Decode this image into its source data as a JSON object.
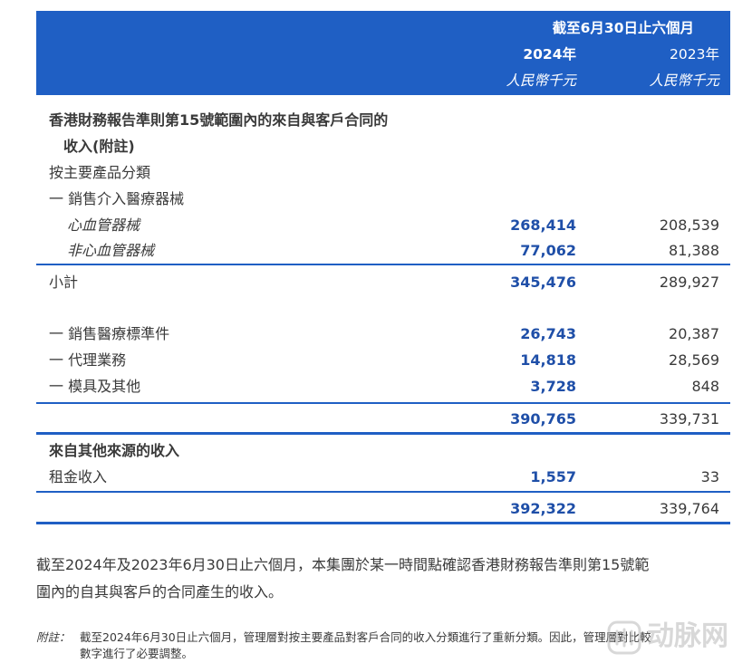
{
  "header": {
    "period": "截至6月30日止六個月",
    "year_current": "2024年",
    "year_prior": "2023年",
    "unit_current": "人民幣千元",
    "unit_prior": "人民幣千元"
  },
  "section1": {
    "title_line1": "香港財務報告準則第15號範圍內的來自與客戶合同的",
    "title_line2": "收入(附註)",
    "subtitle": "按主要產品分類",
    "group1_label": "一 銷售介入醫療器械",
    "rows": [
      {
        "label": "心血管器械",
        "v2024": "268,414",
        "v2023": "208,539"
      },
      {
        "label": "非心血管器械",
        "v2024": "77,062",
        "v2023": "81,388"
      }
    ],
    "subtotal": {
      "label": "小計",
      "v2024": "345,476",
      "v2023": "289,927"
    },
    "other_rows": [
      {
        "label": "一 銷售醫療標準件",
        "v2024": "26,743",
        "v2023": "20,387"
      },
      {
        "label": "一 代理業務",
        "v2024": "14,818",
        "v2023": "28,569"
      },
      {
        "label": "一 模具及其他",
        "v2024": "3,728",
        "v2023": "848"
      }
    ],
    "total": {
      "v2024": "390,765",
      "v2023": "339,731"
    }
  },
  "section2": {
    "title": "來自其他來源的收入",
    "rows": [
      {
        "label": "租金收入",
        "v2024": "1,557",
        "v2023": "33"
      }
    ],
    "total": {
      "v2024": "392,322",
      "v2023": "339,764"
    }
  },
  "note": {
    "line1": "截至2024年及2023年6月30日止六個月，本集團於某一時間點確認香港財務報告準則第15號範",
    "line2": "圍內的自其與客戶的合同產生的收入。"
  },
  "footnote": {
    "label": "附註：",
    "line1": "截至2024年6月30日止六個月，管理層對按主要產品對客戶合同的收入分類進行了重新分類。因此，管理層對比較",
    "line2": "數字進行了必要調整。"
  },
  "watermark": {
    "text": "动脉网"
  },
  "colors": {
    "header_bg": "#1f5fc4",
    "rule": "#1f5fc4",
    "value_2024": "#1f4fa8"
  }
}
